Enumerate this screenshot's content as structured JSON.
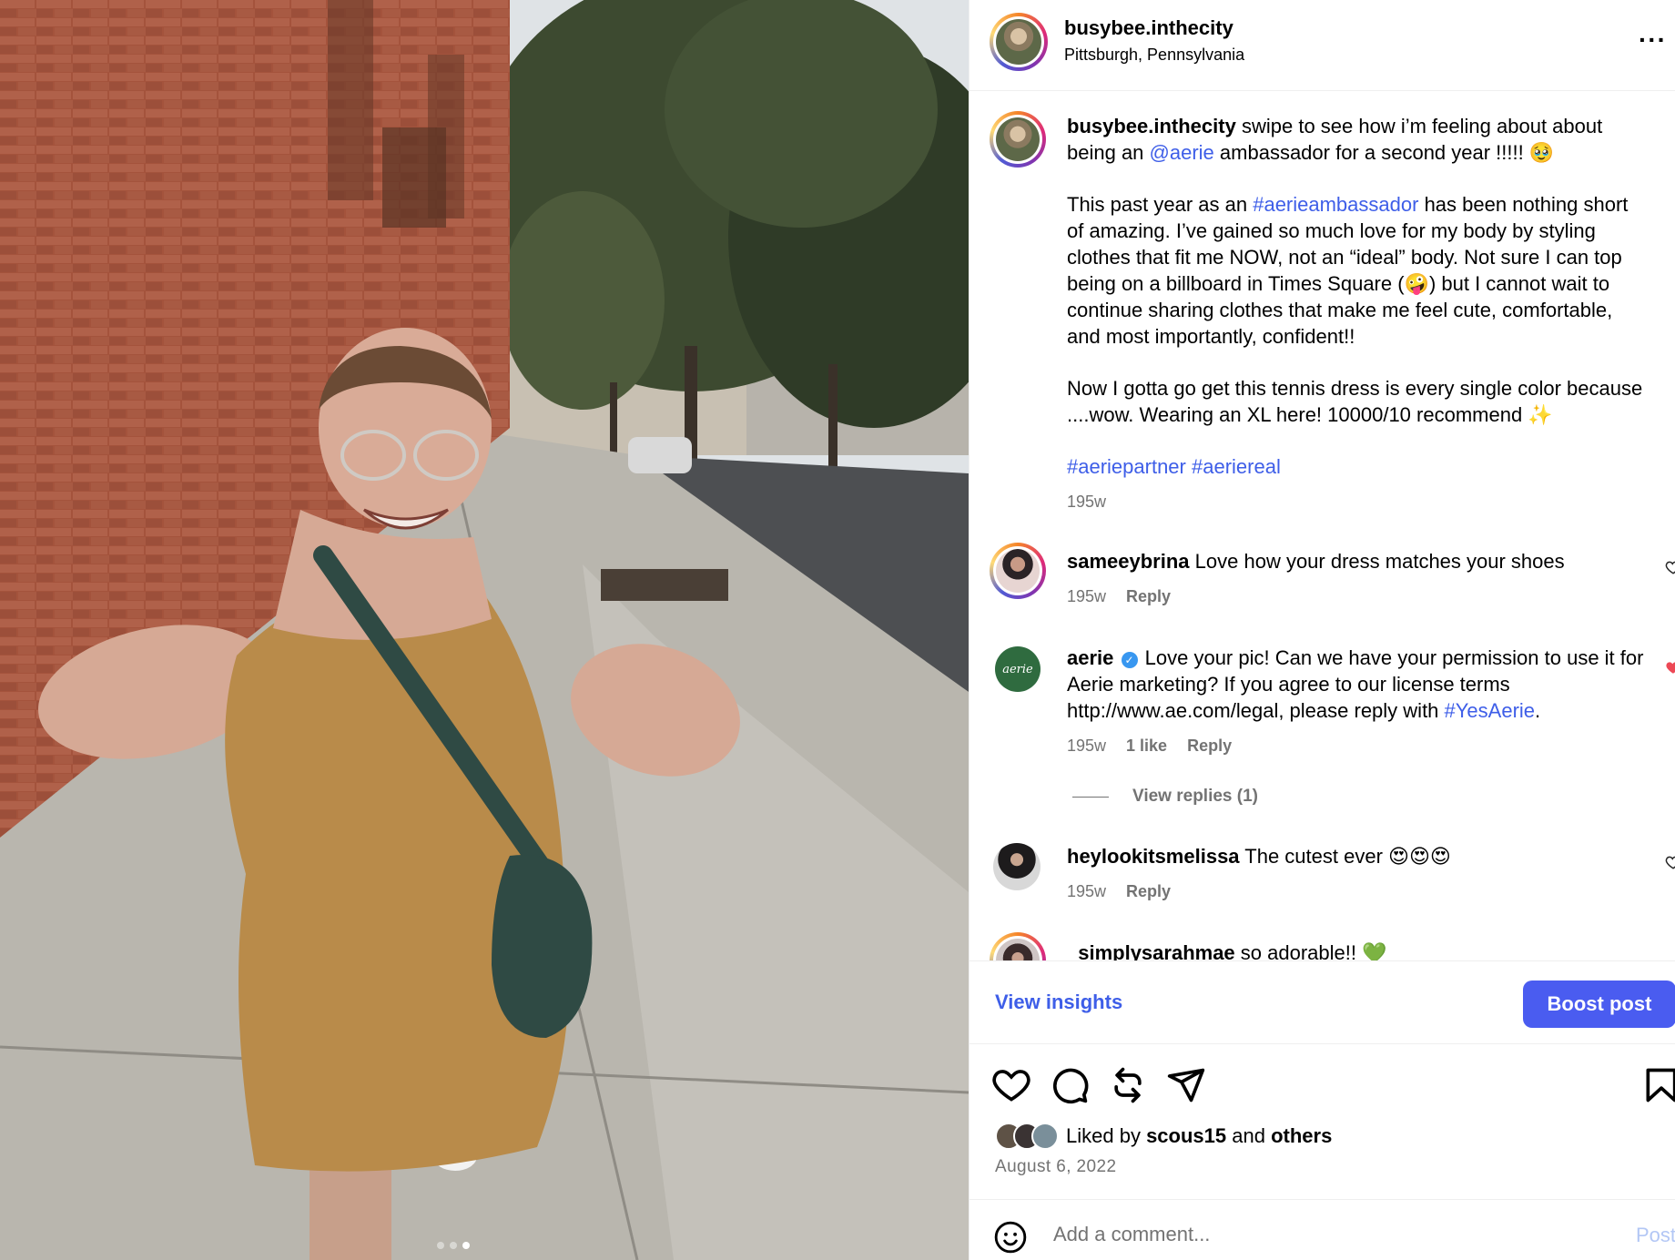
{
  "post": {
    "username": "busybee.inthecity",
    "location": "Pittsburgh, Pennsylvania",
    "more_icon": "more-horizontal-icon",
    "more_label": "···",
    "photo_slide_current": 3,
    "photo_slide_total": 3
  },
  "caption": {
    "username": "busybee.inthecity",
    "p1_text_a": "swipe to see how i’m feeling about about being an ",
    "p1_mention": "@aerie",
    "p1_text_b": " ambassador for a second year !!!!! 🥹",
    "p2_text_a": "This past year as an ",
    "p2_hashtag": "#aerieambassador",
    "p2_text_b": " has been nothing short of amazing. I’ve gained so much love for my body by styling clothes that fit me NOW, not an “ideal” body. Not sure I can top being on a billboard in Times Square (🤪) but I cannot wait to continue sharing clothes that make me feel cute, comfortable, and most importantly, confident!!",
    "p3_text": "Now I gotta go get this tennis dress is every single color because ....wow. Wearing an XL here! 10000/10 recommend ✨",
    "hashtag1": "#aeriepartner",
    "hashtag2": "#aeriereal",
    "time": "195w"
  },
  "comments": [
    {
      "username": "sameeybrina",
      "text": "Love how your dress matches your shoes",
      "time": "195w",
      "reply": "Reply"
    },
    {
      "username": "aerie",
      "avatar_label": "aerie",
      "text_a": "Love your pic! Can we have your permission to use it for Aerie marketing? If you agree to our license terms http://www.ae.com/legal, please reply with ",
      "hashtag": "#YesAerie",
      "text_b": ".",
      "time": "195w",
      "likes": "1 like",
      "reply": "Reply",
      "view_replies": "View replies (1)",
      "liked": true
    },
    {
      "username": "heylookitsmelissa",
      "text": "The cutest ever 😍😍😍",
      "time": "195w",
      "reply": "Reply"
    },
    {
      "username": "_simplysarahmae",
      "text": "so adorable!! 💚"
    }
  ],
  "insights": {
    "view_label": "View insights",
    "boost_label": "Boost post"
  },
  "actions": {
    "liked_by_prefix": "Liked by ",
    "liked_by_user": "scous15",
    "liked_by_mid": " and ",
    "liked_by_others": "others",
    "date": "August 6, 2022"
  },
  "add_comment": {
    "placeholder": "Add a comment...",
    "post_label": "Post"
  },
  "colors": {
    "link": "#3e5ee8",
    "boost": "#4a5cf0",
    "heart_red": "#ed4956",
    "muted": "#737373"
  }
}
